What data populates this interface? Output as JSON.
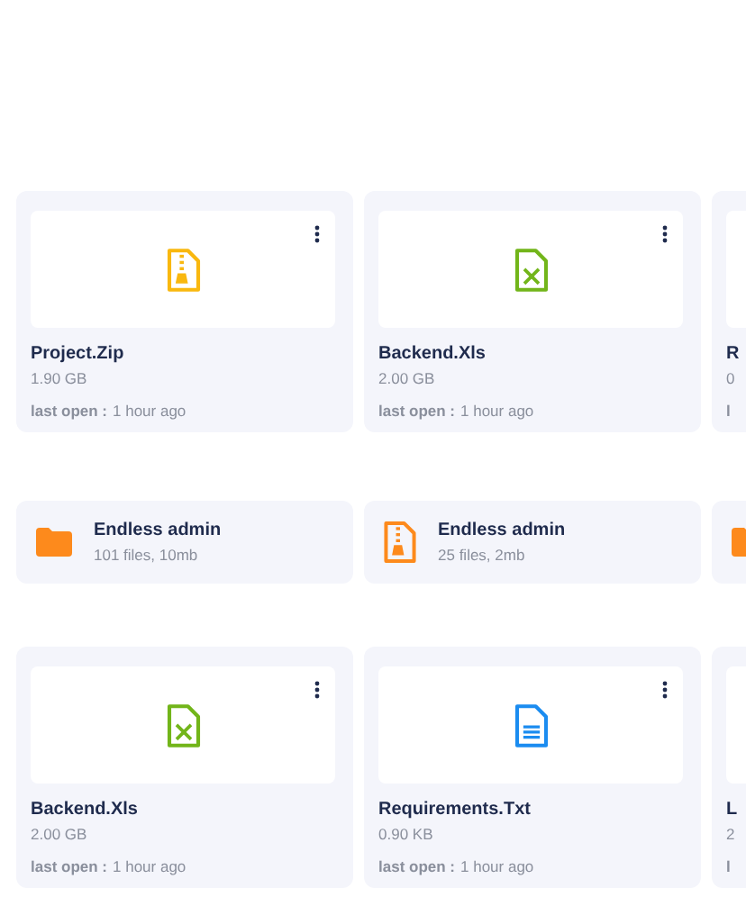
{
  "sections": [
    {
      "kind": "files",
      "cards": [
        {
          "kind": "zip",
          "name": "Project.Zip",
          "size": "1.90 GB",
          "last_open_label": "last open :",
          "last_open": "1 hour ago"
        },
        {
          "kind": "xls",
          "name": "Backend.Xls",
          "size": "2.00 GB",
          "last_open_label": "last open :",
          "last_open": "1 hour ago"
        },
        {
          "name": "R",
          "size": "0",
          "last_open_label": "l"
        }
      ]
    },
    {
      "kind": "folders",
      "cards": [
        {
          "kind": "folder",
          "name": "Endless admin",
          "info": "101 files, 10mb"
        },
        {
          "kind": "zip",
          "name": "Endless admin",
          "info": "25 files, 2mb"
        },
        {
          "kind": "folder"
        }
      ]
    },
    {
      "kind": "files",
      "cards": [
        {
          "kind": "xls",
          "name": "Backend.Xls",
          "size": "2.00 GB",
          "last_open_label": "last open :",
          "last_open": "1 hour ago"
        },
        {
          "kind": "txt",
          "name": "Requirements.Txt",
          "size": "0.90 KB",
          "last_open_label": "last open :",
          "last_open": "1 hour ago"
        },
        {
          "name": "L",
          "size": "2",
          "last_open_label": "l"
        }
      ]
    }
  ]
}
